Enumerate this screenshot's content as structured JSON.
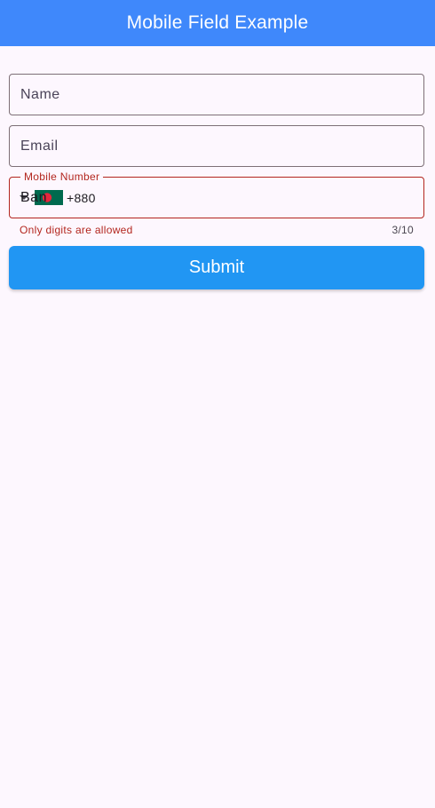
{
  "app_bar": {
    "title": "Mobile Field Example",
    "color": "#3f88fb"
  },
  "form": {
    "name_field": {
      "placeholder": "Name",
      "value": ""
    },
    "email_field": {
      "placeholder": "Email",
      "value": ""
    },
    "mobile_field": {
      "label": "Mobile Number",
      "country_flag": "bangladesh-flag-icon",
      "dial_code": "+880",
      "value": "Ban",
      "error": "Only digits are allowed",
      "counter": "3/10",
      "error_color": "#b3261e"
    },
    "submit": {
      "label": "Submit",
      "color": "#2196f3"
    }
  }
}
